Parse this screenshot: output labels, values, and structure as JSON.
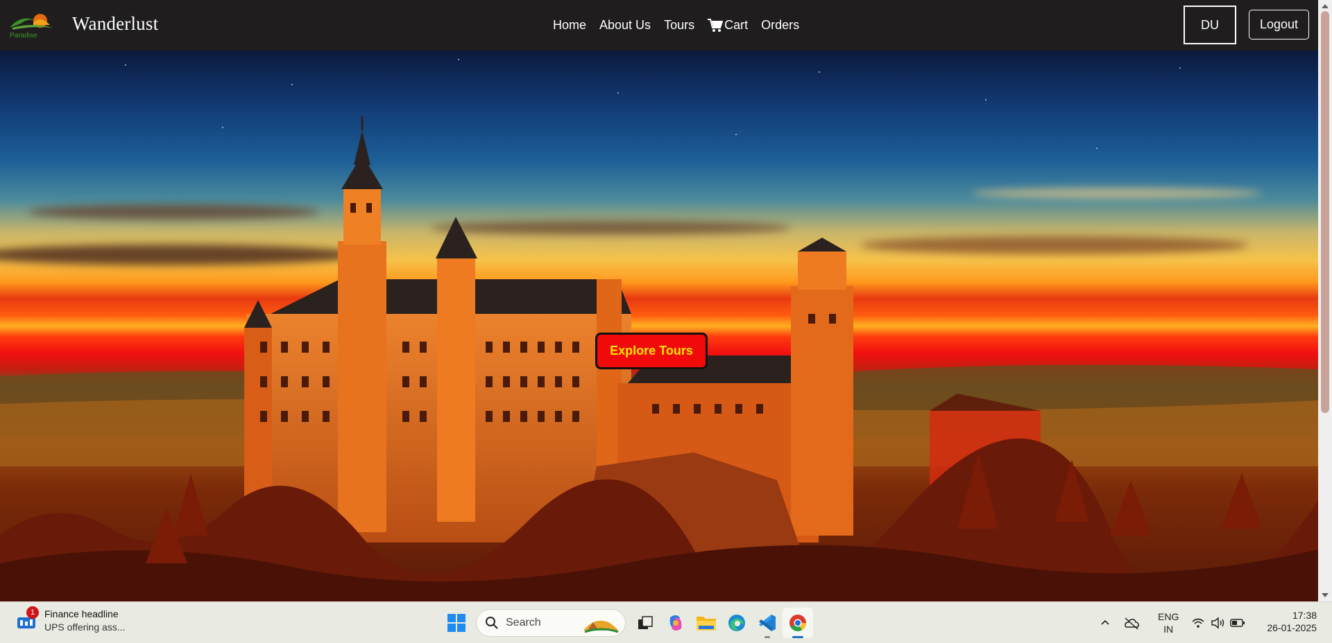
{
  "navbar": {
    "logo_text": "Paradise",
    "brand": "Wanderlust",
    "links": [
      {
        "label": "Home"
      },
      {
        "label": "About Us"
      },
      {
        "label": "Tours"
      },
      {
        "label": "Cart",
        "icon": "cart-icon"
      },
      {
        "label": "Orders"
      }
    ],
    "user_initials": "DU",
    "logout_label": "Logout"
  },
  "hero": {
    "cta_label": "Explore Tours",
    "colors": {
      "cta_bg": "#f00a0a",
      "cta_text": "#ffe600"
    }
  },
  "taskbar": {
    "widget": {
      "title": "Finance headline",
      "subtitle": "UPS offering ass...",
      "badge": "1"
    },
    "search_placeholder": "Search",
    "apps": [
      "windows-start-icon",
      "search",
      "task-view-icon",
      "copilot-icon",
      "file-explorer-icon",
      "edge-icon",
      "vscode-icon",
      "chrome-icon"
    ],
    "tray": {
      "lang_line1": "ENG",
      "lang_line2": "IN",
      "time": "17:38",
      "date": "26-01-2025"
    }
  }
}
